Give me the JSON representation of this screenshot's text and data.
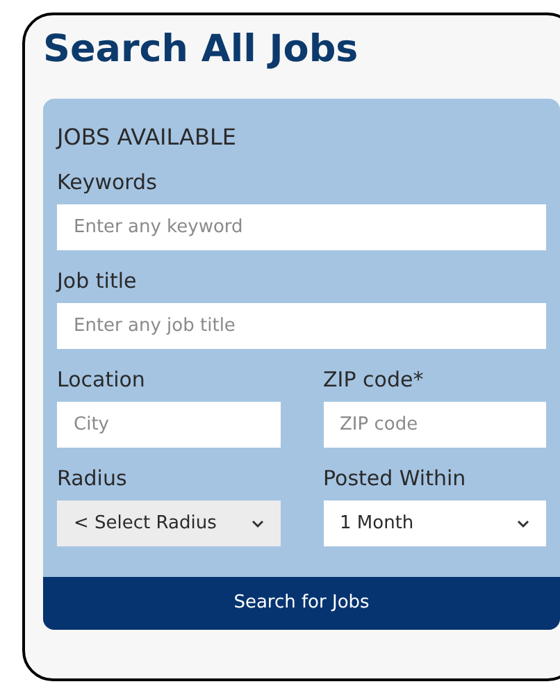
{
  "title": "Search All Jobs",
  "panel": {
    "heading": "JOBS AVAILABLE",
    "rows": [
      [
        {
          "label": "Keywords",
          "kind": "text",
          "placeholder": "Enter any keyword"
        }
      ],
      [
        {
          "label": "Job title",
          "kind": "text",
          "placeholder": "Enter any job title"
        }
      ],
      [
        {
          "label": "Location",
          "kind": "text",
          "placeholder": "City"
        },
        {
          "label": "ZIP code*",
          "kind": "text",
          "placeholder": "ZIP code"
        }
      ],
      [
        {
          "label": "Radius",
          "kind": "select",
          "value": "< Select Radius",
          "disabled": true
        },
        {
          "label": "Posted Within",
          "kind": "select",
          "value": "1 Month",
          "disabled": false
        }
      ]
    ],
    "button": "Search for Jobs"
  }
}
